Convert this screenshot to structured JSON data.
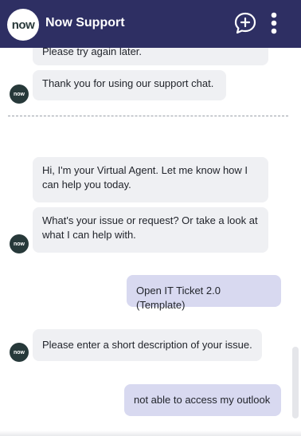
{
  "header": {
    "logo_text": "now",
    "title": "Now Support",
    "bg_color": "#2e2f63",
    "new_chat_icon": "chat-plus-icon",
    "menu_icon": "more-vertical-icon"
  },
  "messages": [
    {
      "sender": "agent",
      "text": "Please try again later."
    },
    {
      "sender": "agent",
      "text": "Thank you for using our support chat."
    },
    {
      "sender": "agent",
      "text": "Hi, I'm your Virtual Agent. Let me know how I can help you today."
    },
    {
      "sender": "agent",
      "text": "What's your issue or request? Or take a look at what I can help with."
    },
    {
      "sender": "user",
      "text": "Open IT Ticket 2.0 (Template)"
    },
    {
      "sender": "agent",
      "text": "Please enter a short description of your issue."
    },
    {
      "sender": "user",
      "text": "not able to access my outlook"
    }
  ],
  "bot_avatar_text": "now"
}
